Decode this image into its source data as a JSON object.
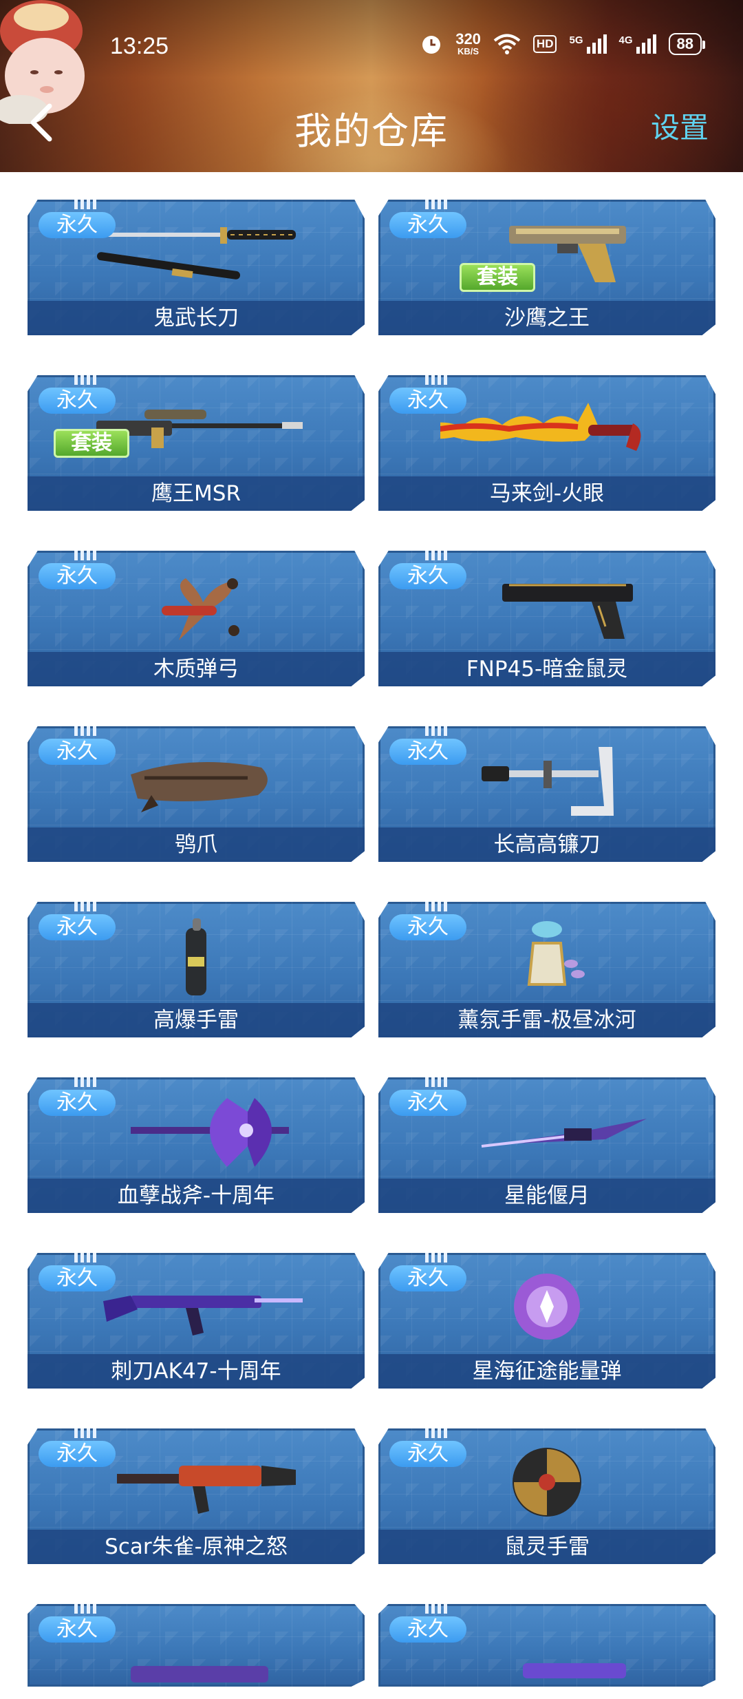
{
  "status_bar": {
    "time": "13:25",
    "net_speed_value": "320",
    "net_speed_unit": "KB/S",
    "hd_label": "HD",
    "signal1_label": "5G",
    "signal2_label": "4G",
    "battery": "88"
  },
  "header": {
    "title": "我的仓库",
    "settings_label": "设置"
  },
  "items": [
    {
      "badge": "永久",
      "name": "鬼武长刀",
      "suit": ""
    },
    {
      "badge": "永久",
      "name": "沙鹰之王",
      "suit": "套装"
    },
    {
      "badge": "永久",
      "name": "鹰王MSR",
      "suit": "套装"
    },
    {
      "badge": "永久",
      "name": "马来剑-火眼",
      "suit": ""
    },
    {
      "badge": "永久",
      "name": "木质弹弓",
      "suit": ""
    },
    {
      "badge": "永久",
      "name": "FNP45-暗金鼠灵",
      "suit": ""
    },
    {
      "badge": "永久",
      "name": "鸮爪",
      "suit": ""
    },
    {
      "badge": "永久",
      "name": "长高高镰刀",
      "suit": ""
    },
    {
      "badge": "永久",
      "name": "高爆手雷",
      "suit": ""
    },
    {
      "badge": "永久",
      "name": "薰氛手雷-极昼冰河",
      "suit": ""
    },
    {
      "badge": "永久",
      "name": "血孽战斧-十周年",
      "suit": ""
    },
    {
      "badge": "永久",
      "name": "星能偃月",
      "suit": ""
    },
    {
      "badge": "永久",
      "name": "刺刀AK47-十周年",
      "suit": ""
    },
    {
      "badge": "永久",
      "name": "星海征途能量弹",
      "suit": ""
    },
    {
      "badge": "永久",
      "name": "Scar朱雀-原神之怒",
      "suit": ""
    },
    {
      "badge": "永久",
      "name": "鼠灵手雷",
      "suit": ""
    },
    {
      "badge": "永久",
      "name": "",
      "suit": ""
    },
    {
      "badge": "永久",
      "name": "",
      "suit": ""
    }
  ]
}
